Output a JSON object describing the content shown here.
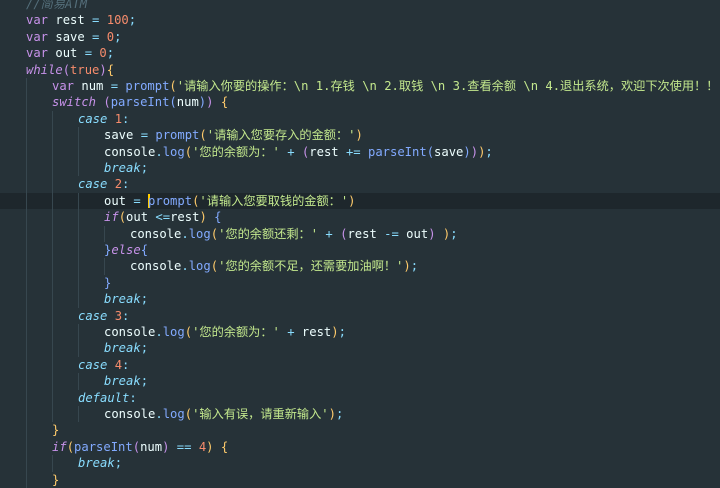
{
  "editor": {
    "active_line": 12,
    "lines": [
      {
        "indent": 0,
        "tokens": [
          [
            "cm",
            "//简易ATM"
          ]
        ]
      },
      {
        "indent": 0,
        "tokens": [
          [
            "kw",
            "var"
          ],
          [
            "id",
            " rest "
          ],
          [
            "pun",
            "="
          ],
          [
            "id",
            " "
          ],
          [
            "num",
            "100"
          ],
          [
            "pun",
            ";"
          ]
        ]
      },
      {
        "indent": 0,
        "tokens": [
          [
            "kw",
            "var"
          ],
          [
            "id",
            " save "
          ],
          [
            "pun",
            "="
          ],
          [
            "id",
            " "
          ],
          [
            "num",
            "0"
          ],
          [
            "pun",
            ";"
          ]
        ]
      },
      {
        "indent": 0,
        "tokens": [
          [
            "kw",
            "var"
          ],
          [
            "id",
            " out "
          ],
          [
            "pun",
            "="
          ],
          [
            "id",
            " "
          ],
          [
            "num",
            "0"
          ],
          [
            "pun",
            ";"
          ]
        ]
      },
      {
        "indent": 0,
        "tokens": [
          [
            "ctl",
            "while"
          ],
          [
            "p2",
            "("
          ],
          [
            "num",
            "true"
          ],
          [
            "p2",
            ")"
          ],
          [
            "p1",
            "{"
          ]
        ]
      },
      {
        "indent": 1,
        "tokens": [
          [
            "kw",
            "var"
          ],
          [
            "id",
            " num "
          ],
          [
            "pun",
            "="
          ],
          [
            "id",
            " "
          ],
          [
            "fn",
            "prompt"
          ],
          [
            "p1",
            "("
          ],
          [
            "str",
            "'请输入你要的操作：\\n 1.存钱 \\n 2.取钱 \\n 3.查看余额 \\n 4.退出系统，欢迎下次使用！！'"
          ],
          [
            "p1",
            ")"
          ]
        ]
      },
      {
        "indent": 1,
        "tokens": [
          [
            "ctl",
            "switch"
          ],
          [
            "id",
            " "
          ],
          [
            "p2",
            "("
          ],
          [
            "fn",
            "parseInt"
          ],
          [
            "p3",
            "("
          ],
          [
            "id",
            "num"
          ],
          [
            "p3",
            ")"
          ],
          [
            "p2",
            ")"
          ],
          [
            "id",
            " "
          ],
          [
            "p1",
            "{"
          ]
        ]
      },
      {
        "indent": 2,
        "tokens": [
          [
            "case",
            "case"
          ],
          [
            "id",
            " "
          ],
          [
            "num",
            "1"
          ],
          [
            "pun",
            ":"
          ]
        ]
      },
      {
        "indent": 3,
        "tokens": [
          [
            "id",
            "save "
          ],
          [
            "pun",
            "="
          ],
          [
            "id",
            " "
          ],
          [
            "fn",
            "prompt"
          ],
          [
            "p1",
            "("
          ],
          [
            "str",
            "'请输入您要存入的金额：'"
          ],
          [
            "p1",
            ")"
          ]
        ]
      },
      {
        "indent": 3,
        "tokens": [
          [
            "id",
            "console"
          ],
          [
            "pun",
            "."
          ],
          [
            "fn",
            "log"
          ],
          [
            "p1",
            "("
          ],
          [
            "str",
            "'您的余额为：'"
          ],
          [
            "id",
            " "
          ],
          [
            "pun",
            "+"
          ],
          [
            "id",
            " "
          ],
          [
            "p2",
            "("
          ],
          [
            "id",
            "rest "
          ],
          [
            "pun",
            "+="
          ],
          [
            "id",
            " "
          ],
          [
            "fn",
            "parseInt"
          ],
          [
            "p3",
            "("
          ],
          [
            "id",
            "save"
          ],
          [
            "p3",
            ")"
          ],
          [
            "p2",
            ")"
          ],
          [
            "p1",
            ")"
          ],
          [
            "pun",
            ";"
          ]
        ]
      },
      {
        "indent": 3,
        "tokens": [
          [
            "case",
            "break"
          ],
          [
            "pun",
            ";"
          ]
        ]
      },
      {
        "indent": 2,
        "tokens": [
          [
            "case",
            "case"
          ],
          [
            "id",
            " "
          ],
          [
            "num",
            "2"
          ],
          [
            "pun",
            ":"
          ]
        ]
      },
      {
        "indent": 3,
        "cursor": true,
        "tokens": [
          [
            "id",
            "out "
          ],
          [
            "pun",
            "="
          ],
          [
            "id",
            " "
          ],
          [
            "fn",
            "prompt"
          ],
          [
            "p1",
            "("
          ],
          [
            "str",
            "'请输入您要取钱的金额：'"
          ],
          [
            "p1",
            ")"
          ]
        ]
      },
      {
        "indent": 3,
        "tokens": [
          [
            "ctl",
            "if"
          ],
          [
            "p1",
            "("
          ],
          [
            "id",
            "out "
          ],
          [
            "pun",
            "<="
          ],
          [
            "id",
            "rest"
          ],
          [
            "p1",
            ")"
          ],
          [
            "id",
            " "
          ],
          [
            "p3",
            "{"
          ]
        ]
      },
      {
        "indent": 4,
        "tokens": [
          [
            "id",
            "console"
          ],
          [
            "pun",
            "."
          ],
          [
            "fn",
            "log"
          ],
          [
            "p1",
            "("
          ],
          [
            "str",
            "'您的余额还剩：'"
          ],
          [
            "id",
            " "
          ],
          [
            "pun",
            "+"
          ],
          [
            "id",
            " "
          ],
          [
            "p2",
            "("
          ],
          [
            "id",
            "rest "
          ],
          [
            "pun",
            "-="
          ],
          [
            "id",
            " out"
          ],
          [
            "p2",
            ")"
          ],
          [
            "id",
            " "
          ],
          [
            "p1",
            ")"
          ],
          [
            "pun",
            ";"
          ]
        ]
      },
      {
        "indent": 3,
        "tokens": [
          [
            "p3",
            "}"
          ],
          [
            "ctl",
            "else"
          ],
          [
            "p3",
            "{"
          ]
        ]
      },
      {
        "indent": 4,
        "tokens": [
          [
            "id",
            "console"
          ],
          [
            "pun",
            "."
          ],
          [
            "fn",
            "log"
          ],
          [
            "p1",
            "("
          ],
          [
            "str",
            "'您的余额不足，还需要加油啊！'"
          ],
          [
            "p1",
            ")"
          ],
          [
            "pun",
            ";"
          ]
        ]
      },
      {
        "indent": 3,
        "tokens": [
          [
            "p3",
            "}"
          ]
        ]
      },
      {
        "indent": 3,
        "tokens": [
          [
            "case",
            "break"
          ],
          [
            "pun",
            ";"
          ]
        ]
      },
      {
        "indent": 2,
        "tokens": [
          [
            "case",
            "case"
          ],
          [
            "id",
            " "
          ],
          [
            "num",
            "3"
          ],
          [
            "pun",
            ":"
          ]
        ]
      },
      {
        "indent": 3,
        "tokens": [
          [
            "id",
            "console"
          ],
          [
            "pun",
            "."
          ],
          [
            "fn",
            "log"
          ],
          [
            "p1",
            "("
          ],
          [
            "str",
            "'您的余额为：'"
          ],
          [
            "id",
            " "
          ],
          [
            "pun",
            "+"
          ],
          [
            "id",
            " rest"
          ],
          [
            "p1",
            ")"
          ],
          [
            "pun",
            ";"
          ]
        ]
      },
      {
        "indent": 3,
        "tokens": [
          [
            "case",
            "break"
          ],
          [
            "pun",
            ";"
          ]
        ]
      },
      {
        "indent": 2,
        "tokens": [
          [
            "case",
            "case"
          ],
          [
            "id",
            " "
          ],
          [
            "num",
            "4"
          ],
          [
            "pun",
            ":"
          ]
        ]
      },
      {
        "indent": 3,
        "tokens": [
          [
            "case",
            "break"
          ],
          [
            "pun",
            ";"
          ]
        ]
      },
      {
        "indent": 2,
        "tokens": [
          [
            "case",
            "default"
          ],
          [
            "pun",
            ":"
          ]
        ]
      },
      {
        "indent": 3,
        "tokens": [
          [
            "id",
            "console"
          ],
          [
            "pun",
            "."
          ],
          [
            "fn",
            "log"
          ],
          [
            "p1",
            "("
          ],
          [
            "str",
            "'输入有误，请重新输入'"
          ],
          [
            "p1",
            ")"
          ],
          [
            "pun",
            ";"
          ]
        ]
      },
      {
        "indent": 1,
        "tokens": [
          [
            "p1",
            "}"
          ]
        ]
      },
      {
        "indent": 1,
        "tokens": [
          [
            "ctl",
            "if"
          ],
          [
            "p1",
            "("
          ],
          [
            "fn",
            "parseInt"
          ],
          [
            "p2",
            "("
          ],
          [
            "id",
            "num"
          ],
          [
            "p2",
            ")"
          ],
          [
            "id",
            " "
          ],
          [
            "pun",
            "=="
          ],
          [
            "id",
            " "
          ],
          [
            "num",
            "4"
          ],
          [
            "p1",
            ")"
          ],
          [
            "id",
            " "
          ],
          [
            "p1",
            "{"
          ]
        ]
      },
      {
        "indent": 2,
        "tokens": [
          [
            "case",
            "break"
          ],
          [
            "pun",
            ";"
          ]
        ]
      },
      {
        "indent": 1,
        "tokens": [
          [
            "p1",
            "}"
          ]
        ]
      }
    ]
  }
}
